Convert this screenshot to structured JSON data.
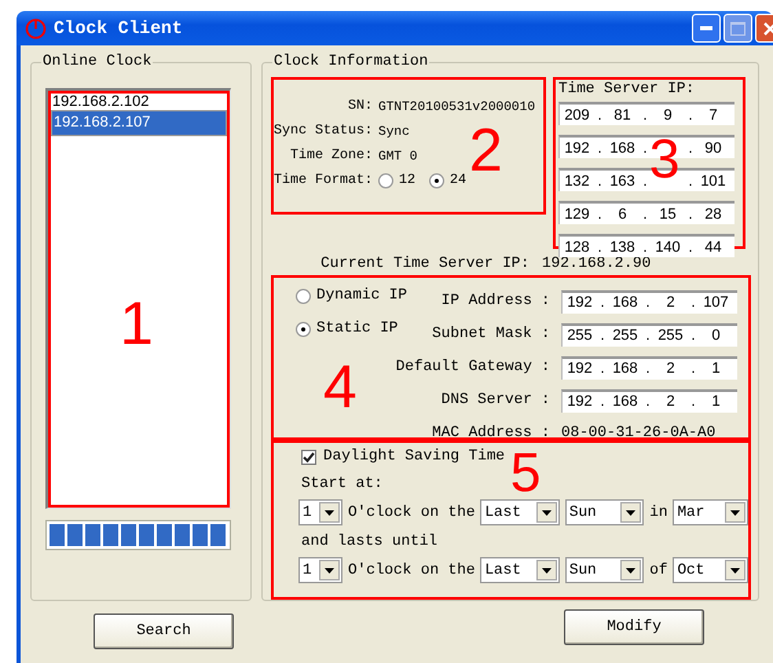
{
  "window": {
    "title": "Clock Client"
  },
  "online_clock": {
    "title": "Online Clock",
    "items": [
      {
        "text": "192.168.2.102",
        "selected": false
      },
      {
        "text": "192.168.2.107",
        "selected": true
      }
    ],
    "progress": {
      "level": 1
    }
  },
  "search_button": "Search",
  "clock_info": {
    "title": "Clock Information",
    "details": [
      {
        "label": "SN:",
        "value": "GTNT20100531v2000010"
      },
      {
        "label": "Sync Status:",
        "value": "Sync"
      },
      {
        "label": "Time Zone:",
        "value": "GMT 0"
      }
    ],
    "time_format": {
      "label": "Time Format:",
      "options": [
        {
          "label": "12",
          "selected": false
        },
        {
          "label": "24",
          "selected": true
        }
      ]
    },
    "time_servers": {
      "title": "Time Server IP:",
      "addresses": [
        [
          {
            "text": "209"
          },
          {
            "text": "81"
          },
          {
            "text": "9"
          },
          {
            "text": "7"
          }
        ],
        [
          {
            "text": "192"
          },
          {
            "text": "168"
          },
          {
            "hidden": true
          },
          {
            "text": "90"
          }
        ],
        [
          {
            "text": "132"
          },
          {
            "text": "163"
          },
          {
            "hidden": true
          },
          {
            "text": "101"
          }
        ],
        [
          {
            "text": "129"
          },
          {
            "text": "6"
          },
          {
            "text": "15"
          },
          {
            "text": "28"
          }
        ],
        [
          {
            "text": "128"
          },
          {
            "text": "138"
          },
          {
            "text": "140"
          },
          {
            "text": "44"
          }
        ]
      ]
    },
    "current_server": {
      "label": "Current Time Server IP:",
      "value": "192.168.2.90"
    },
    "ip_modes": [
      {
        "label": "Dynamic IP",
        "selected": false
      },
      {
        "label": "Static IP",
        "selected": true
      }
    ],
    "ip_fields": [
      {
        "label": "IP Address :",
        "octets": [
          "192",
          "168",
          "2",
          "107"
        ]
      },
      {
        "label": "Subnet Mask :",
        "octets": [
          "255",
          "255",
          "255",
          "0"
        ]
      },
      {
        "label": "Default Gateway :",
        "octets": [
          "192",
          "168",
          "2",
          "1"
        ]
      },
      {
        "label": "DNS Server :",
        "octets": [
          "192",
          "168",
          "2",
          "1"
        ]
      }
    ],
    "mac": {
      "label": "MAC Address :",
      "value": "08-00-31-26-0A-A0"
    },
    "dst": {
      "label": "Daylight Saving Time",
      "checked": true,
      "start_label": "Start at:",
      "start": [
        {
          "kind": "select",
          "value": "1"
        },
        {
          "kind": "text",
          "text": "O'clock on the"
        },
        {
          "kind": "select",
          "value": "Last"
        },
        {
          "kind": "select",
          "value": "Sun"
        },
        {
          "kind": "text",
          "text": "in"
        },
        {
          "kind": "select",
          "value": "Mar"
        }
      ],
      "until_label": "and lasts until",
      "end": [
        {
          "kind": "select",
          "value": "1"
        },
        {
          "kind": "text",
          "text": "O'clock on the"
        },
        {
          "kind": "select",
          "value": "Last"
        },
        {
          "kind": "select",
          "value": "Sun"
        },
        {
          "kind": "text",
          "text": "of"
        },
        {
          "kind": "select",
          "value": "Oct"
        }
      ]
    }
  },
  "modify_button": "Modify",
  "ip_separator": ".",
  "annotations": [
    "1",
    "2",
    "3",
    "4",
    "5"
  ]
}
